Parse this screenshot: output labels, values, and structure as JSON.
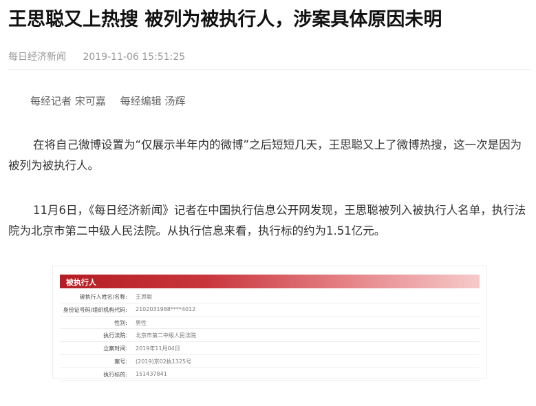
{
  "article": {
    "title": "王思聪又上热搜 被列为被执行人，涉案具体原因未明",
    "source": "每日经济新闻",
    "datetime": "2019-11-06 15:51:25",
    "reporter": "每经记者 宋可嘉",
    "editor": "每经编辑 汤辉",
    "paragraphs": [
      "在将自己微博设置为“仅展示半年内的微博”之后短短几天，王思聪又上了微博热搜，这一次是因为被列为被执行人。",
      "11月6日，《每日经济新闻》记者在中国执行信息公开网发现，王思聪被列入被执行人名单，执行法院为北京市第二中级人民法院。从执行信息来看，执行标的约为1.51亿元。"
    ]
  },
  "figure": {
    "header": "被执行人",
    "rows": [
      {
        "label": "被执行人姓名/名称:",
        "value": "王思聪"
      },
      {
        "label": "身份证号码/组织机构代码:",
        "value": "2102031988****4012"
      },
      {
        "label": "性别:",
        "value": "男性"
      },
      {
        "label": "执行法院:",
        "value": "北京市第二中级人民法院"
      },
      {
        "label": "立案时间:",
        "value": "2019年11月04日"
      },
      {
        "label": "案号:",
        "value": "(2019)京02执1325号"
      },
      {
        "label": "执行标的:",
        "value": "151437841"
      }
    ]
  },
  "colors": {
    "header_red": "#b51c24",
    "header_pink": "#f6caca"
  }
}
